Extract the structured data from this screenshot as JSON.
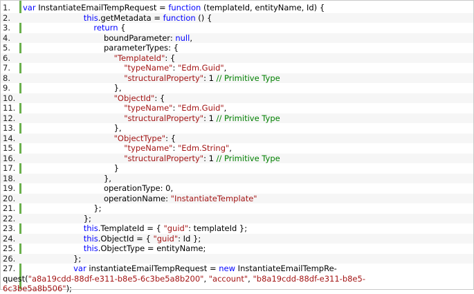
{
  "colors": {
    "keyword": "#0000ff",
    "string": "#a31515",
    "comment": "#008000",
    "gutter_accent": "#6ab04c",
    "alt_row": "#f6f6f6"
  },
  "lines": [
    {
      "n": "1.",
      "tokens": [
        [
          "kw",
          "var "
        ],
        [
          "",
          "InstantiateEmailTempRequest = "
        ],
        [
          "kw",
          "function"
        ],
        [
          "",
          " (templateId, entityName, Id) {"
        ]
      ]
    },
    {
      "n": "2.",
      "tokens": [
        [
          "",
          "                        "
        ],
        [
          "kw",
          "this"
        ],
        [
          "",
          ".getMetadata = "
        ],
        [
          "kw",
          "function"
        ],
        [
          "",
          " () {"
        ]
      ]
    },
    {
      "n": "3.",
      "tokens": [
        [
          "",
          "                            "
        ],
        [
          "kw",
          "return"
        ],
        [
          "",
          " {"
        ]
      ]
    },
    {
      "n": "4.",
      "tokens": [
        [
          "",
          "                                boundParameter: "
        ],
        [
          "kw",
          "null"
        ],
        [
          "",
          ","
        ]
      ]
    },
    {
      "n": "5.",
      "tokens": [
        [
          "",
          "                                parameterTypes: {"
        ]
      ]
    },
    {
      "n": "6.",
      "tokens": [
        [
          "",
          "                                    "
        ],
        [
          "str",
          "\"TemplateId\""
        ],
        [
          "",
          ": {"
        ]
      ]
    },
    {
      "n": "7.",
      "tokens": [
        [
          "",
          "                                        "
        ],
        [
          "str",
          "\"typeName\""
        ],
        [
          "",
          ": "
        ],
        [
          "str",
          "\"Edm.Guid\""
        ],
        [
          "",
          ","
        ]
      ]
    },
    {
      "n": "8.",
      "tokens": [
        [
          "",
          "                                        "
        ],
        [
          "str",
          "\"structuralProperty\""
        ],
        [
          "",
          ": 1 "
        ],
        [
          "cm",
          "// Primitive Type"
        ]
      ]
    },
    {
      "n": "9.",
      "tokens": [
        [
          "",
          "                                    },"
        ]
      ]
    },
    {
      "n": "10.",
      "tokens": [
        [
          "",
          "                                    "
        ],
        [
          "str",
          "\"ObjectId\""
        ],
        [
          "",
          ": {"
        ]
      ]
    },
    {
      "n": "11.",
      "tokens": [
        [
          "",
          "                                        "
        ],
        [
          "str",
          "\"typeName\""
        ],
        [
          "",
          ": "
        ],
        [
          "str",
          "\"Edm.Guid\""
        ],
        [
          "",
          ","
        ]
      ]
    },
    {
      "n": "12.",
      "tokens": [
        [
          "",
          "                                        "
        ],
        [
          "str",
          "\"structuralProperty\""
        ],
        [
          "",
          ": 1 "
        ],
        [
          "cm",
          "// Primitive Type"
        ]
      ]
    },
    {
      "n": "13.",
      "tokens": [
        [
          "",
          "                                    },"
        ]
      ]
    },
    {
      "n": "14.",
      "tokens": [
        [
          "",
          "                                    "
        ],
        [
          "str",
          "\"ObjectType\""
        ],
        [
          "",
          ": {"
        ]
      ]
    },
    {
      "n": "15.",
      "tokens": [
        [
          "",
          "                                        "
        ],
        [
          "str",
          "\"typeName\""
        ],
        [
          "",
          ": "
        ],
        [
          "str",
          "\"Edm.String\""
        ],
        [
          "",
          ","
        ]
      ]
    },
    {
      "n": "16.",
      "tokens": [
        [
          "",
          "                                        "
        ],
        [
          "str",
          "\"structuralProperty\""
        ],
        [
          "",
          ": 1 "
        ],
        [
          "cm",
          "// Primitive Type"
        ]
      ]
    },
    {
      "n": "17.",
      "tokens": [
        [
          "",
          "                                    }"
        ]
      ]
    },
    {
      "n": "18.",
      "tokens": [
        [
          "",
          "                                },"
        ]
      ]
    },
    {
      "n": "19.",
      "tokens": [
        [
          "",
          "                                operationType: 0,"
        ]
      ]
    },
    {
      "n": "20.",
      "tokens": [
        [
          "",
          "                                operationName: "
        ],
        [
          "str",
          "\"InstantiateTemplate\""
        ]
      ]
    },
    {
      "n": "21.",
      "tokens": [
        [
          "",
          "                            };"
        ]
      ]
    },
    {
      "n": "22.",
      "tokens": [
        [
          "",
          "                        };"
        ]
      ]
    },
    {
      "n": "23.",
      "tokens": [
        [
          "",
          "                        "
        ],
        [
          "kw",
          "this"
        ],
        [
          "",
          ".TemplateId = { "
        ],
        [
          "str",
          "\"guid\""
        ],
        [
          "",
          ": templateId };"
        ]
      ]
    },
    {
      "n": "24.",
      "tokens": [
        [
          "",
          "                        "
        ],
        [
          "kw",
          "this"
        ],
        [
          "",
          ".ObjectId = { "
        ],
        [
          "str",
          "\"guid\""
        ],
        [
          "",
          ": Id };"
        ]
      ]
    },
    {
      "n": "25.",
      "tokens": [
        [
          "",
          "                        "
        ],
        [
          "kw",
          "this"
        ],
        [
          "",
          ".ObjectType = entityName;"
        ]
      ]
    },
    {
      "n": "26.",
      "tokens": [
        [
          "",
          "                    };"
        ]
      ]
    },
    {
      "n": "27.",
      "tokens": [
        [
          "",
          "                    "
        ],
        [
          "kw",
          "var"
        ],
        [
          "",
          " instantiateEmailTempRequest = "
        ],
        [
          "kw",
          "new"
        ],
        [
          "",
          " InstantiateEmailTempRe-"
        ]
      ]
    }
  ],
  "wrapped_lines": [
    {
      "tokens": [
        [
          "",
          "quest("
        ],
        [
          "str",
          "\"a8a19cdd-88df-e311-b8e5-6c3be5a8b200\""
        ],
        [
          "",
          ", "
        ],
        [
          "str",
          "\"account\""
        ],
        [
          "",
          ", "
        ],
        [
          "str",
          "\"b8a19cdd-88df-e311-b8e5-"
        ]
      ]
    },
    {
      "tokens": [
        [
          "str",
          "6c3be5a8b506\""
        ],
        [
          "",
          ");"
        ]
      ]
    }
  ]
}
